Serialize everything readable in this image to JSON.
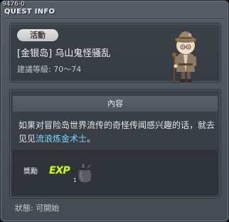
{
  "window": {
    "id": "9476-0",
    "title": "QUEST INFO"
  },
  "quest": {
    "category": "活動",
    "name": "[金银岛] 乌山鬼怪骚乱",
    "level_range": "建議等級: 70～74"
  },
  "content": {
    "header": "內容",
    "description_before": "如果对冒险岛世界流传的奇怪传闻感兴趣的话，就去见见",
    "npc_link": "流浪炼金术士",
    "description_after": "。"
  },
  "rewards": {
    "label": "獎勵",
    "exp_label": "EXP",
    "item_count": "1",
    "item_icon": "bag-icon"
  },
  "status": "狀態: 可開始",
  "colors": {
    "link": "#7fd4ff",
    "exp": "#c8f53c",
    "window_bg": "#4f565f"
  }
}
